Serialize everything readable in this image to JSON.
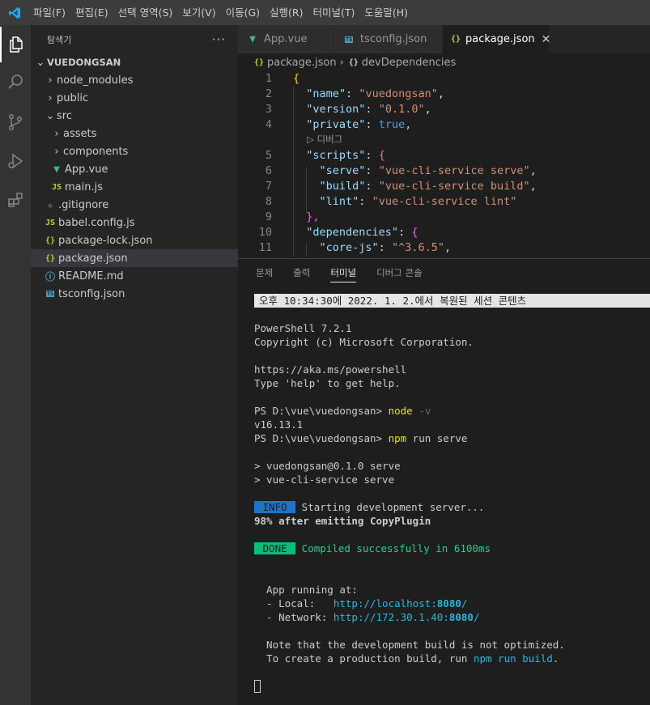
{
  "menubar": {
    "items": [
      "파일(F)",
      "편집(E)",
      "선택 영역(S)",
      "보기(V)",
      "이동(G)",
      "실행(R)",
      "터미널(T)",
      "도움말(H)"
    ]
  },
  "sidebar": {
    "title": "탐색기",
    "more": "···",
    "root": "VUEDONGSAN",
    "tree": [
      {
        "label": "node_modules",
        "type": "folder"
      },
      {
        "label": "public",
        "type": "folder"
      },
      {
        "label": "src",
        "type": "folder-open"
      },
      {
        "label": "assets",
        "type": "folder"
      },
      {
        "label": "components",
        "type": "folder"
      },
      {
        "label": "App.vue",
        "type": "vue"
      },
      {
        "label": "main.js",
        "type": "js"
      },
      {
        "label": ".gitignore",
        "type": "git"
      },
      {
        "label": "babel.config.js",
        "type": "js"
      },
      {
        "label": "package-lock.json",
        "type": "json"
      },
      {
        "label": "package.json",
        "type": "json"
      },
      {
        "label": "README.md",
        "type": "info"
      },
      {
        "label": "tsconfig.json",
        "type": "ts"
      }
    ]
  },
  "tabs": [
    {
      "label": "App.vue",
      "icon": "vue-icon"
    },
    {
      "label": "tsconfig.json",
      "icon": "ts-icon"
    },
    {
      "label": "package.json",
      "icon": "json-icon",
      "close": "✕"
    }
  ],
  "breadcrumb": {
    "file": "package.json",
    "sep": "›",
    "symbol": "devDependencies"
  },
  "code": {
    "codelens": "▷ 디버그",
    "lines": [
      {
        "n": "1",
        "t": "{"
      },
      {
        "n": "2",
        "k": "\"name\"",
        "v": "\"vuedongsan\"",
        "end": ","
      },
      {
        "n": "3",
        "k": "\"version\"",
        "v": "\"0.1.0\"",
        "end": ","
      },
      {
        "n": "4",
        "k": "\"private\"",
        "v": "true",
        "end": ","
      },
      {
        "n": "5",
        "k": "\"scripts\"",
        "v": "{",
        "end": ""
      },
      {
        "n": "6",
        "k": "\"serve\"",
        "v": "\"vue-cli-service serve\"",
        "end": ","
      },
      {
        "n": "7",
        "k": "\"build\"",
        "v": "\"vue-cli-service build\"",
        "end": ","
      },
      {
        "n": "8",
        "k": "\"lint\"",
        "v": "\"vue-cli-service lint\"",
        "end": ""
      },
      {
        "n": "9",
        "t": "},"
      },
      {
        "n": "10",
        "k": "\"dependencies\"",
        "v": "{",
        "end": ""
      },
      {
        "n": "11",
        "k": "\"core-js\"",
        "v": "\"^3.6.5\"",
        "end": ","
      }
    ]
  },
  "panel": {
    "tabs": [
      "문제",
      "출력",
      "터미널",
      "디버그 콘솔"
    ],
    "active_tab": "터미널"
  },
  "terminal": {
    "restored": "오후 10:34:30에 2022. 1. 2.에서 복원된 세션 콘텐츠",
    "ps_version": "PowerShell 7.2.1",
    "copyright": "Copyright (c) Microsoft Corporation.",
    "url": "https://aka.ms/powershell",
    "help": "Type 'help' to get help.",
    "prompt": "PS D:\\vue\\vuedongsan> ",
    "cmd1": "node",
    "cmd1_arg": " -v",
    "node_version": "v16.13.1",
    "cmd2": "npm",
    "cmd2_arg": " run serve",
    "out1": "> vuedongsan@0.1.0 serve",
    "out2": "> vue-cli-service serve",
    "info_badge": " INFO ",
    "info_text": " Starting development server...",
    "progress": "98% after emitting CopyPlugin",
    "done_badge": " DONE ",
    "done_text": " Compiled successfully in 6100ms",
    "app_running": "  App running at:",
    "local_label": "  - Local:   ",
    "local_url_a": "http://localhost:",
    "local_url_port": "8080",
    "local_url_b": "/",
    "network_label": "  - Network: ",
    "network_url_a": "http://172.30.1.40:",
    "network_url_port": "8080",
    "network_url_b": "/",
    "note1": "  Note that the development build is not optimized.",
    "note2_a": "  To create a production build, run ",
    "note2_cmd": "npm run build",
    "note2_b": "."
  }
}
